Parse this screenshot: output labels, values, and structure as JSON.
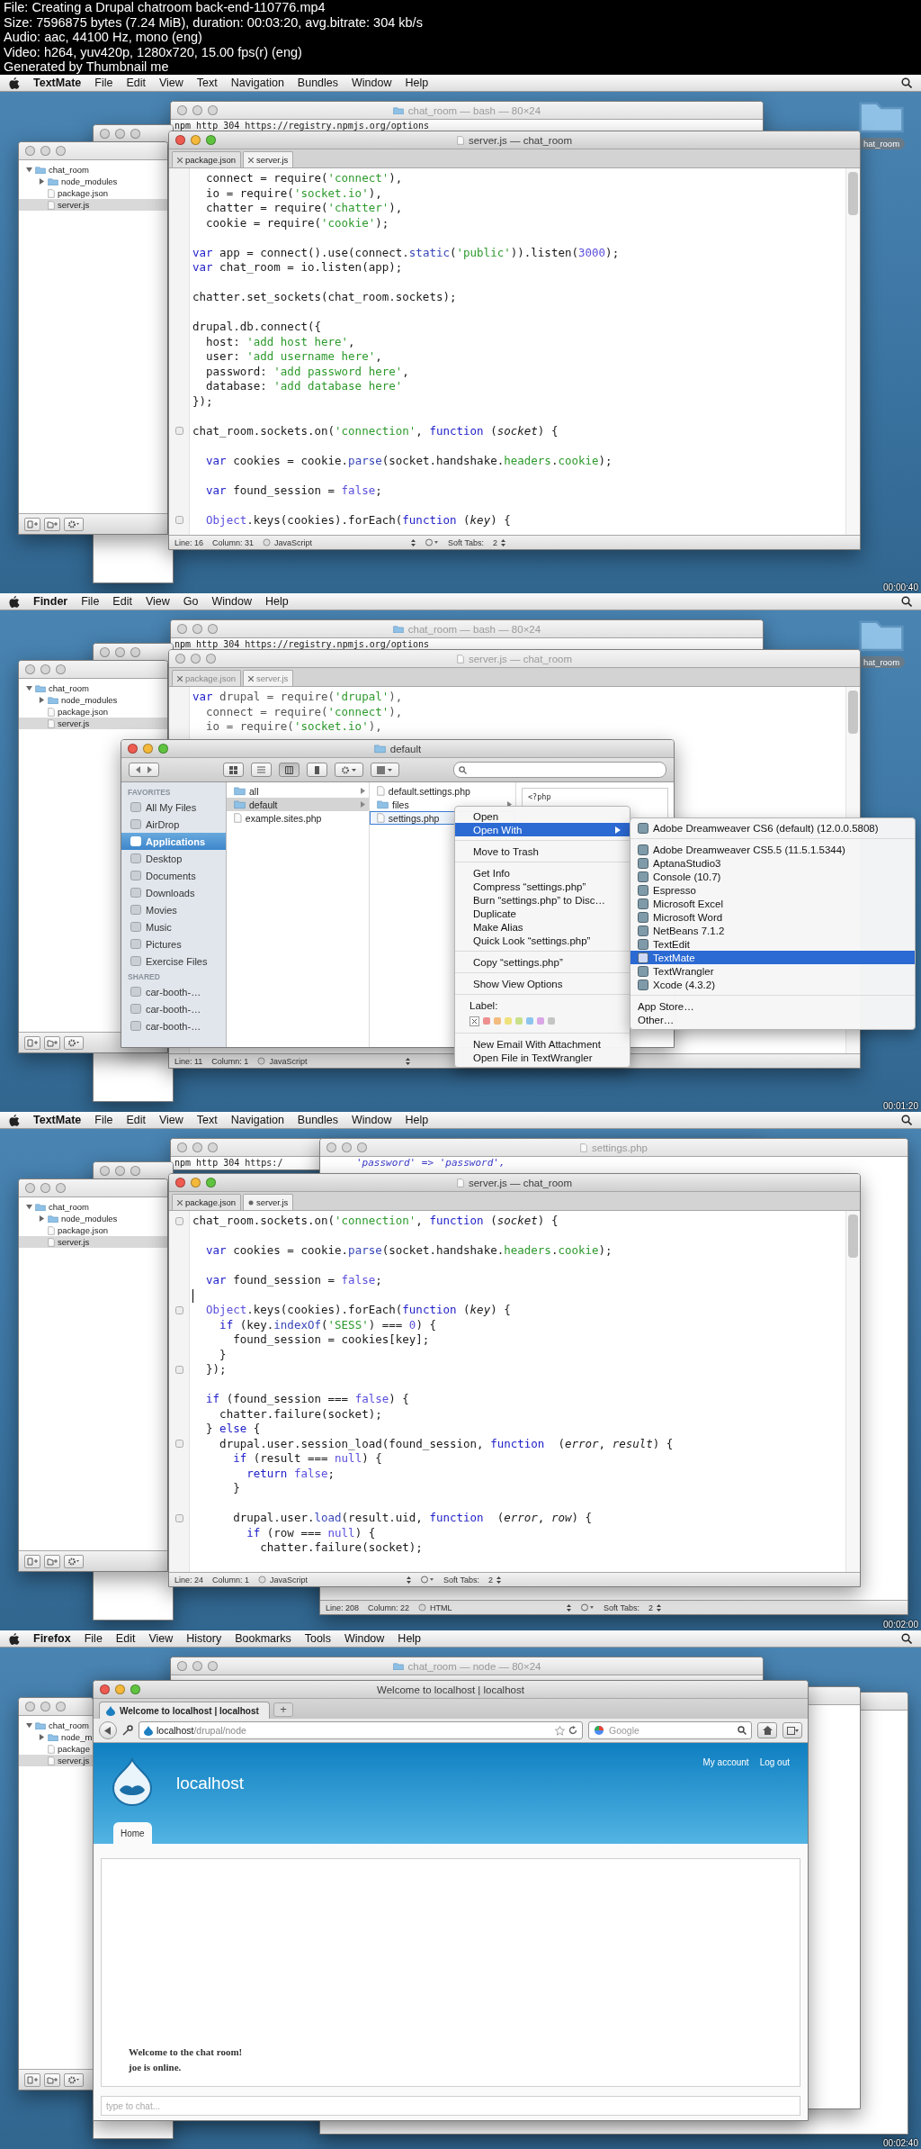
{
  "file_info": [
    "File: Creating a Drupal chatroom back-end-110776.mp4",
    "Size: 7596875 bytes (7.24 MiB), duration: 00:03:20, avg.bitrate: 304 kb/s",
    "Audio: aac, 44100 Hz, mono (eng)",
    "Video: h264, yuv420p, 1280x720, 15.00 fps(r) (eng)",
    "Generated by Thumbnail me"
  ],
  "frames": [
    {
      "kind": "editor",
      "timestamp": "00:00:40",
      "menubar": {
        "app": "TextMate",
        "items": [
          "File",
          "Edit",
          "View",
          "Text",
          "Navigation",
          "Bundles",
          "Window",
          "Help"
        ]
      },
      "terminal": {
        "title": "chat_room — bash — 80×24",
        "line": "npm http 304 https://registry.npmjs.org/options"
      },
      "desktop_folder": "hat_room",
      "drawer": {
        "tree": [
          {
            "label": "chat_room",
            "expanded": true,
            "selected": false,
            "children": [
              {
                "label": "node_modules",
                "expanded": false,
                "selected": false
              },
              {
                "label": "package.json",
                "selected": false
              },
              {
                "label": "server.js",
                "selected": true
              }
            ]
          }
        ]
      },
      "editor": {
        "title": "server.js — chat_room",
        "active": true,
        "tabs": [
          {
            "label": "package.json",
            "selected": false,
            "modified": false
          },
          {
            "label": "server.js",
            "selected": true,
            "modified": false
          }
        ],
        "lines": [
          {
            "tokens": [
              {
                "kind": "plain",
                "text": "  connect = require("
              },
              {
                "kind": "str",
                "text": "'connect'"
              },
              {
                "kind": "plain",
                "text": "),"
              }
            ]
          },
          {
            "tokens": [
              {
                "kind": "plain",
                "text": "  io = require("
              },
              {
                "kind": "str",
                "text": "'socket.io'"
              },
              {
                "kind": "plain",
                "text": "),"
              }
            ]
          },
          {
            "tokens": [
              {
                "kind": "plain",
                "text": "  chatter = require("
              },
              {
                "kind": "str",
                "text": "'chatter'"
              },
              {
                "kind": "plain",
                "text": "),"
              }
            ]
          },
          {
            "tokens": [
              {
                "kind": "plain",
                "text": "  cookie = require("
              },
              {
                "kind": "str",
                "text": "'cookie'"
              },
              {
                "kind": "plain",
                "text": ");"
              }
            ]
          },
          {
            "gap_before": true,
            "tokens": [
              {
                "kind": "kw",
                "text": "var"
              },
              {
                "kind": "plain",
                "text": " app = connect().use(connect."
              },
              {
                "kind": "fn",
                "text": "static"
              },
              {
                "kind": "plain",
                "text": "("
              },
              {
                "kind": "str",
                "text": "'public'"
              },
              {
                "kind": "plain",
                "text": ")).listen("
              },
              {
                "kind": "const",
                "text": "3000"
              },
              {
                "kind": "plain",
                "text": ");"
              }
            ]
          },
          {
            "tokens": [
              {
                "kind": "kw",
                "text": "var"
              },
              {
                "kind": "plain",
                "text": " chat_room = io.listen(app);"
              }
            ]
          },
          {
            "gap_before": true,
            "tokens": [
              {
                "kind": "plain",
                "text": "chatter.set_sockets(chat_room.sockets);"
              }
            ]
          },
          {
            "gap_before": true,
            "tokens": [
              {
                "kind": "plain",
                "text": "drupal.db.connect({"
              }
            ]
          },
          {
            "tokens": [
              {
                "kind": "plain",
                "text": "  host: "
              },
              {
                "kind": "str",
                "text": "'add host here'"
              },
              {
                "kind": "plain",
                "text": ","
              }
            ]
          },
          {
            "tokens": [
              {
                "kind": "plain",
                "text": "  user: "
              },
              {
                "kind": "str",
                "text": "'add username here'"
              },
              {
                "kind": "plain",
                "text": ","
              }
            ]
          },
          {
            "tokens": [
              {
                "kind": "plain",
                "text": "  password: "
              },
              {
                "kind": "str",
                "text": "'add password here'"
              },
              {
                "kind": "plain",
                "text": ","
              }
            ]
          },
          {
            "tokens": [
              {
                "kind": "plain",
                "text": "  database: "
              },
              {
                "kind": "str",
                "text": "'add database here'"
              }
            ]
          },
          {
            "tokens": [
              {
                "kind": "plain",
                "text": "});"
              }
            ]
          },
          {
            "gap_before": true,
            "fold": true,
            "tokens": [
              {
                "kind": "plain",
                "text": "chat_room.sockets.on("
              },
              {
                "kind": "str",
                "text": "'connection'"
              },
              {
                "kind": "plain",
                "text": ", "
              },
              {
                "kind": "kw",
                "text": "function"
              },
              {
                "kind": "plain",
                "text": " ("
              },
              {
                "kind": "param",
                "text": "socket"
              },
              {
                "kind": "plain",
                "text": ") {"
              }
            ]
          },
          {
            "gap_before": true,
            "tokens": [
              {
                "kind": "kw",
                "text": "  var"
              },
              {
                "kind": "plain",
                "text": " cookies = cookie."
              },
              {
                "kind": "fn",
                "text": "parse"
              },
              {
                "kind": "plain",
                "text": "(socket.handshake."
              },
              {
                "kind": "prop",
                "text": "headers"
              },
              {
                "kind": "plain",
                "text": "."
              },
              {
                "kind": "prop",
                "text": "cookie"
              },
              {
                "kind": "plain",
                "text": ");"
              }
            ]
          },
          {
            "gap_before": true,
            "tokens": [
              {
                "kind": "kw",
                "text": "  var"
              },
              {
                "kind": "plain",
                "text": " found_session = "
              },
              {
                "kind": "const",
                "text": "false"
              },
              {
                "kind": "plain",
                "text": ";"
              }
            ]
          },
          {
            "gap_before": true,
            "fold": true,
            "tokens": [
              {
                "kind": "const",
                "text": "  Object"
              },
              {
                "kind": "plain",
                "text": ".keys(cookies).forEach("
              },
              {
                "kind": "kw",
                "text": "function"
              },
              {
                "kind": "plain",
                "text": " ("
              },
              {
                "kind": "param",
                "text": "key"
              },
              {
                "kind": "plain",
                "text": ") {"
              }
            ]
          }
        ],
        "status": {
          "line": "Line: 16",
          "column": "Column: 31",
          "language": "JavaScript",
          "tabs": "Soft Tabs:",
          "tab_size": "2"
        }
      }
    },
    {
      "kind": "finder",
      "timestamp": "00:01:20",
      "menubar": {
        "app": "Finder",
        "items": [
          "File",
          "Edit",
          "View",
          "Go",
          "Window",
          "Help"
        ]
      },
      "terminal": {
        "title": "chat_room — bash — 80×24",
        "line": "npm http 304 https://registry.npmjs.org/options"
      },
      "desktop_folder": "hat_room",
      "drawer": {
        "tree": [
          {
            "label": "chat_room",
            "expanded": true,
            "selected": false,
            "children": [
              {
                "label": "node_modules",
                "expanded": false,
                "selected": false
              },
              {
                "label": "package.json",
                "selected": false
              },
              {
                "label": "server.js",
                "selected": true
              }
            ]
          }
        ]
      },
      "editor": {
        "title": "server.js — chat_room",
        "active": false,
        "tabs": [
          {
            "label": "package.json",
            "selected": false,
            "modified": false
          },
          {
            "label": "server.js",
            "selected": true,
            "modified": false
          }
        ],
        "lines": [
          {
            "tokens": [
              {
                "kind": "kw",
                "text": "var"
              },
              {
                "kind": "plain",
                "text": " drupal = require("
              },
              {
                "kind": "str",
                "text": "'drupal'"
              },
              {
                "kind": "plain",
                "text": "),"
              }
            ]
          },
          {
            "tokens": [
              {
                "kind": "plain",
                "text": "  connect = require("
              },
              {
                "kind": "str",
                "text": "'connect'"
              },
              {
                "kind": "plain",
                "text": "),"
              }
            ]
          },
          {
            "tokens": [
              {
                "kind": "plain",
                "text": "  io = require("
              },
              {
                "kind": "str",
                "text": "'socket.io'"
              },
              {
                "kind": "plain",
                "text": "),"
              }
            ]
          }
        ],
        "status": {
          "line": "Line: 11",
          "column": "Column: 1",
          "language": "JavaScript"
        }
      },
      "finder": {
        "title": "default",
        "sidebar": [
          {
            "heading": "FAVORITES",
            "items": [
              {
                "label": "All My Files",
                "selected": false
              },
              {
                "label": "AirDrop",
                "selected": false
              },
              {
                "label": "Applications",
                "selected": true
              },
              {
                "label": "Desktop",
                "selected": false
              },
              {
                "label": "Documents",
                "selected": false
              },
              {
                "label": "Downloads",
                "selected": false
              },
              {
                "label": "Movies",
                "selected": false
              },
              {
                "label": "Music",
                "selected": false
              },
              {
                "label": "Pictures",
                "selected": false
              },
              {
                "label": "Exercise Files",
                "selected": false
              }
            ]
          },
          {
            "heading": "SHARED",
            "items": [
              {
                "label": "car-booth-…",
                "selected": false
              },
              {
                "label": "car-booth-…",
                "selected": false
              },
              {
                "label": "car-booth-…",
                "selected": false
              }
            ]
          }
        ],
        "columns": [
          [
            {
              "label": "all",
              "kind": "folder",
              "selected": false
            },
            {
              "label": "default",
              "kind": "folder",
              "selected": true
            },
            {
              "label": "example.sites.php",
              "kind": "file",
              "selected": false
            }
          ],
          [
            {
              "label": "default.settings.php",
              "kind": "file",
              "selected": false
            },
            {
              "label": "files",
              "kind": "folder",
              "selected": false
            },
            {
              "label": "settings.php",
              "kind": "file",
              "selected": true
            }
          ]
        ],
        "preview": "<?php"
      },
      "context_menu": [
        {
          "kind": "item",
          "label": "Open",
          "selected": false
        },
        {
          "kind": "submenu",
          "label": "Open With",
          "selected": true
        },
        {
          "kind": "separator"
        },
        {
          "kind": "item",
          "label": "Move to Trash",
          "selected": false
        },
        {
          "kind": "separator"
        },
        {
          "kind": "item",
          "label": "Get Info",
          "selected": false
        },
        {
          "kind": "item",
          "label": "Compress “settings.php”",
          "selected": false
        },
        {
          "kind": "item",
          "label": "Burn “settings.php” to Disc…",
          "selected": false
        },
        {
          "kind": "item",
          "label": "Duplicate",
          "selected": false
        },
        {
          "kind": "item",
          "label": "Make Alias",
          "selected": false
        },
        {
          "kind": "item",
          "label": "Quick Look “settings.php”",
          "selected": false
        },
        {
          "kind": "separator"
        },
        {
          "kind": "item",
          "label": "Copy “settings.php”",
          "selected": false
        },
        {
          "kind": "separator"
        },
        {
          "kind": "item",
          "label": "Show View Options",
          "selected": false
        },
        {
          "kind": "separator"
        },
        {
          "kind": "heading",
          "label": "Label:"
        },
        {
          "kind": "colors",
          "colors": [
            {
              "color": "#ee8f8f"
            },
            {
              "color": "#f3bb7e"
            },
            {
              "color": "#efe17c"
            },
            {
              "color": "#c8e08a"
            },
            {
              "color": "#8cc5ee"
            },
            {
              "color": "#d9a6e6"
            },
            {
              "color": "#c4c4c4"
            }
          ]
        },
        {
          "kind": "separator"
        },
        {
          "kind": "item",
          "label": "New Email With Attachment",
          "selected": false
        },
        {
          "kind": "item",
          "label": "Open File in TextWrangler",
          "selected": false
        }
      ],
      "submenu": [
        {
          "kind": "item",
          "label": "Adobe Dreamweaver CS6 (default) (12.0.0.5808)",
          "selected": false
        },
        {
          "kind": "separator"
        },
        {
          "kind": "item",
          "label": "Adobe Dreamweaver CS5.5 (11.5.1.5344)",
          "selected": false
        },
        {
          "kind": "item",
          "label": "AptanaStudio3",
          "selected": false
        },
        {
          "kind": "item",
          "label": "Console (10.7)",
          "selected": false
        },
        {
          "kind": "item",
          "label": "Espresso",
          "selected": false
        },
        {
          "kind": "item",
          "label": "Microsoft Excel",
          "selected": false
        },
        {
          "kind": "item",
          "label": "Microsoft Word",
          "selected": false
        },
        {
          "kind": "item",
          "label": "NetBeans 7.1.2",
          "selected": false
        },
        {
          "kind": "item",
          "label": "TextEdit",
          "selected": false
        },
        {
          "kind": "item",
          "label": "TextMate",
          "selected": true
        },
        {
          "kind": "item",
          "label": "TextWrangler",
          "selected": false
        },
        {
          "kind": "item",
          "label": "Xcode (4.3.2)",
          "selected": false
        },
        {
          "kind": "separator"
        },
        {
          "kind": "text",
          "label": "App Store…",
          "selected": false
        },
        {
          "kind": "text",
          "label": "Other…",
          "selected": false
        }
      ]
    },
    {
      "kind": "editor",
      "timestamp": "00:02:00",
      "menubar": {
        "app": "TextMate",
        "items": [
          "File",
          "Edit",
          "View",
          "Text",
          "Navigation",
          "Bundles",
          "Window",
          "Help"
        ]
      },
      "terminal": {
        "line": "npm http 304 https:/"
      },
      "settings_window": {
        "title": "settings.php",
        "line": "'password' => 'password',",
        "status": {
          "line": "Line: 208",
          "column": "Column: 22",
          "language": "HTML",
          "tabs": "Soft Tabs:",
          "tab_size": "2"
        }
      },
      "drawer": {
        "tree": [
          {
            "label": "chat_room",
            "expanded": true,
            "selected": false,
            "children": [
              {
                "label": "node_modules",
                "expanded": false,
                "selected": false
              },
              {
                "label": "package.json",
                "selected": false
              },
              {
                "label": "server.js",
                "selected": true
              }
            ]
          }
        ]
      },
      "editor": {
        "title": "server.js — chat_room",
        "active": true,
        "tabs": [
          {
            "label": "package.json",
            "selected": false,
            "modified": false
          },
          {
            "label": "server.js",
            "selected": true,
            "modified": true
          }
        ],
        "lines": [
          {
            "fold": true,
            "tokens": [
              {
                "kind": "plain",
                "text": "chat_room.sockets.on("
              },
              {
                "kind": "str",
                "text": "'connection'"
              },
              {
                "kind": "plain",
                "text": ", "
              },
              {
                "kind": "kw",
                "text": "function"
              },
              {
                "kind": "plain",
                "text": " ("
              },
              {
                "kind": "param",
                "text": "socket"
              },
              {
                "kind": "plain",
                "text": ") {"
              }
            ]
          },
          {
            "gap_before": true,
            "tokens": [
              {
                "kind": "kw",
                "text": "  var"
              },
              {
                "kind": "plain",
                "text": " cookies = cookie."
              },
              {
                "kind": "fn",
                "text": "parse"
              },
              {
                "kind": "plain",
                "text": "(socket.handshake."
              },
              {
                "kind": "prop",
                "text": "headers"
              },
              {
                "kind": "plain",
                "text": "."
              },
              {
                "kind": "prop",
                "text": "cookie"
              },
              {
                "kind": "plain",
                "text": ");"
              }
            ]
          },
          {
            "gap_before": true,
            "tokens": [
              {
                "kind": "kw",
                "text": "  var"
              },
              {
                "kind": "plain",
                "text": " found_session = "
              },
              {
                "kind": "const",
                "text": "false"
              },
              {
                "kind": "plain",
                "text": ";"
              }
            ]
          },
          {
            "gap_before": true,
            "cursor_before": true,
            "fold": true,
            "tokens": [
              {
                "kind": "const",
                "text": "  Object"
              },
              {
                "kind": "plain",
                "text": ".keys(cookies).forEach("
              },
              {
                "kind": "kw",
                "text": "function"
              },
              {
                "kind": "plain",
                "text": " ("
              },
              {
                "kind": "param",
                "text": "key"
              },
              {
                "kind": "plain",
                "text": ") {"
              }
            ]
          },
          {
            "tokens": [
              {
                "kind": "kw",
                "text": "    if"
              },
              {
                "kind": "plain",
                "text": " (key."
              },
              {
                "kind": "fn",
                "text": "indexOf"
              },
              {
                "kind": "plain",
                "text": "("
              },
              {
                "kind": "str",
                "text": "'SESS'"
              },
              {
                "kind": "plain",
                "text": ") === "
              },
              {
                "kind": "const",
                "text": "0"
              },
              {
                "kind": "plain",
                "text": ") {"
              }
            ]
          },
          {
            "tokens": [
              {
                "kind": "plain",
                "text": "      found_session = cookies[key];"
              }
            ]
          },
          {
            "tokens": [
              {
                "kind": "plain",
                "text": "    }"
              }
            ]
          },
          {
            "fold": true,
            "tokens": [
              {
                "kind": "plain",
                "text": "  });"
              }
            ]
          },
          {
            "gap_before": true,
            "tokens": [
              {
                "kind": "kw",
                "text": "  if"
              },
              {
                "kind": "plain",
                "text": " (found_session === "
              },
              {
                "kind": "const",
                "text": "false"
              },
              {
                "kind": "plain",
                "text": ") {"
              }
            ]
          },
          {
            "tokens": [
              {
                "kind": "plain",
                "text": "    chatter.failure(socket);"
              }
            ]
          },
          {
            "tokens": [
              {
                "kind": "plain",
                "text": "  } "
              },
              {
                "kind": "kw",
                "text": "else"
              },
              {
                "kind": "plain",
                "text": " {"
              }
            ]
          },
          {
            "fold": true,
            "tokens": [
              {
                "kind": "plain",
                "text": "    drupal.user.session_load(found_session, "
              },
              {
                "kind": "kw",
                "text": "function"
              },
              {
                "kind": "plain",
                "text": "  ("
              },
              {
                "kind": "param",
                "text": "error"
              },
              {
                "kind": "plain",
                "text": ", "
              },
              {
                "kind": "param",
                "text": "result"
              },
              {
                "kind": "plain",
                "text": ") {"
              }
            ]
          },
          {
            "tokens": [
              {
                "kind": "kw",
                "text": "      if"
              },
              {
                "kind": "plain",
                "text": " (result === "
              },
              {
                "kind": "const",
                "text": "null"
              },
              {
                "kind": "plain",
                "text": ") {"
              }
            ]
          },
          {
            "tokens": [
              {
                "kind": "kw",
                "text": "        return"
              },
              {
                "kind": "const",
                "text": " false"
              },
              {
                "kind": "plain",
                "text": ";"
              }
            ]
          },
          {
            "tokens": [
              {
                "kind": "plain",
                "text": "      }"
              }
            ]
          },
          {
            "gap_before": true,
            "fold": true,
            "tokens": [
              {
                "kind": "plain",
                "text": "      drupal.user."
              },
              {
                "kind": "fn",
                "text": "load"
              },
              {
                "kind": "plain",
                "text": "(result.uid, "
              },
              {
                "kind": "kw",
                "text": "function"
              },
              {
                "kind": "plain",
                "text": "  ("
              },
              {
                "kind": "param",
                "text": "error"
              },
              {
                "kind": "plain",
                "text": ", "
              },
              {
                "kind": "param",
                "text": "row"
              },
              {
                "kind": "plain",
                "text": ") {"
              }
            ]
          },
          {
            "tokens": [
              {
                "kind": "kw",
                "text": "        if"
              },
              {
                "kind": "plain",
                "text": " (row === "
              },
              {
                "kind": "const",
                "text": "null"
              },
              {
                "kind": "plain",
                "text": ") {"
              }
            ]
          },
          {
            "tokens": [
              {
                "kind": "plain",
                "text": "          chatter.failure(socket);"
              }
            ]
          }
        ],
        "status": {
          "line": "Line: 24",
          "column": "Column: 1",
          "language": "JavaScript",
          "tabs": "Soft Tabs:",
          "tab_size": "2"
        }
      }
    },
    {
      "kind": "browser",
      "timestamp": "00:02:40",
      "menubar": {
        "app": "Firefox",
        "items": [
          "File",
          "Edit",
          "View",
          "History",
          "Bookmarks",
          "Tools",
          "Window",
          "Help"
        ]
      },
      "terminal": {
        "title": "chat_room — node — 80×24"
      },
      "drawer": {
        "tree": [
          {
            "label": "chat_room",
            "expanded": true,
            "selected": false,
            "children": [
              {
                "label": "node_m",
                "expanded": false,
                "selected": false
              },
              {
                "label": "package",
                "selected": false
              },
              {
                "label": "server.js",
                "selected": true
              }
            ]
          }
        ]
      },
      "browser": {
        "title": "Welcome to localhost | localhost",
        "tab": "Welcome to localhost | localhost",
        "new_tab": "+",
        "url_host": "localhost",
        "url_path": "/drupal/node",
        "search_placeholder": "Google",
        "site_name": "localhost",
        "user_links": [
          "My account",
          "Log out"
        ],
        "nav_tabs": [
          {
            "label": "Home",
            "selected": true
          }
        ],
        "messages": [
          "Welcome to the chat room!",
          "joe is online."
        ],
        "chat_placeholder": "type to chat..."
      }
    }
  ]
}
